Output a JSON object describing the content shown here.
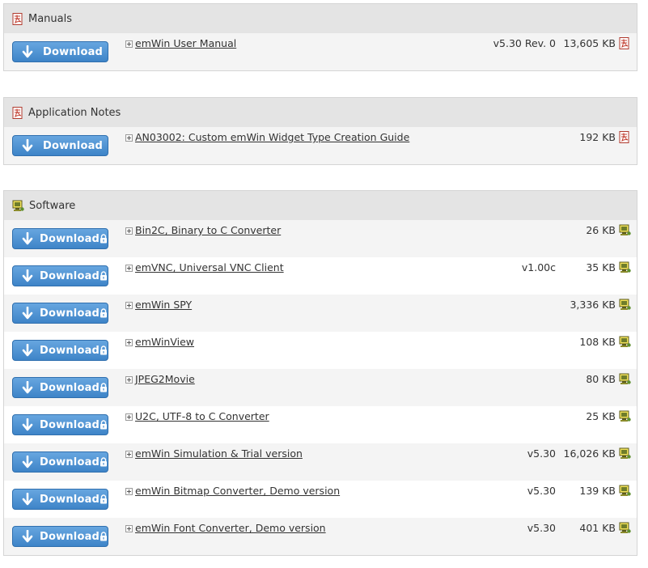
{
  "sections": [
    {
      "title": "Manuals",
      "icon": "pdf-icon",
      "rows": [
        {
          "button": "Download",
          "locked": false,
          "name": "emWin User Manual",
          "version": "v5.30 Rev. 0",
          "size": "13,605 KB",
          "file_icon": "pdf-icon"
        }
      ]
    },
    {
      "title": "Application Notes",
      "icon": "pdf-icon",
      "rows": [
        {
          "button": "Download",
          "locked": false,
          "name": "AN03002: Custom emWin Widget Type Creation Guide",
          "version": "",
          "size": "192 KB",
          "file_icon": "pdf-icon"
        }
      ]
    },
    {
      "title": "Software",
      "icon": "software-icon",
      "rows": [
        {
          "button": "Download",
          "locked": true,
          "name": "Bin2C, Binary to C Converter",
          "version": "",
          "size": "26 KB",
          "file_icon": "software-icon"
        },
        {
          "button": "Download",
          "locked": true,
          "name": "emVNC, Universal VNC Client",
          "version": "v1.00c",
          "size": "35 KB",
          "file_icon": "software-icon"
        },
        {
          "button": "Download",
          "locked": true,
          "name": "emWin SPY",
          "version": "",
          "size": "3,336 KB",
          "file_icon": "software-icon"
        },
        {
          "button": "Download",
          "locked": true,
          "name": "emWinView",
          "version": "",
          "size": "108 KB",
          "file_icon": "software-icon"
        },
        {
          "button": "Download",
          "locked": true,
          "name": "JPEG2Movie",
          "version": "",
          "size": "80 KB",
          "file_icon": "software-icon"
        },
        {
          "button": "Download",
          "locked": true,
          "name": "U2C, UTF-8 to C Converter",
          "version": "",
          "size": "25 KB",
          "file_icon": "software-icon"
        },
        {
          "button": "Download",
          "locked": true,
          "name": "emWin Simulation & Trial version",
          "version": "v5.30",
          "size": "16,026 KB",
          "file_icon": "software-icon"
        },
        {
          "button": "Download",
          "locked": true,
          "name": "emWin Bitmap Converter, Demo version",
          "version": "v5.30",
          "size": "139 KB",
          "file_icon": "software-icon"
        },
        {
          "button": "Download",
          "locked": true,
          "name": "emWin Font Converter, Demo version",
          "version": "v5.30",
          "size": "401 KB",
          "file_icon": "software-icon"
        }
      ]
    }
  ],
  "colors": {
    "header_bg": "#e4e4e4",
    "row_shade": "#f4f4f4",
    "button_top": "#67a6e0",
    "button_bottom": "#3e84c8"
  }
}
